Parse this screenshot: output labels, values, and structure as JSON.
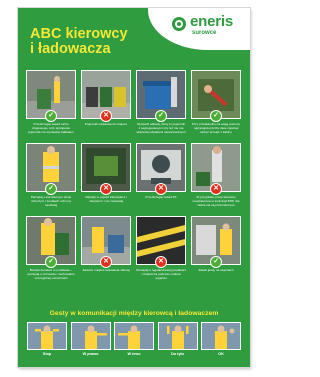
{
  "brand": {
    "name": "eneris",
    "sub": "surowce",
    "logo_icon": "eneris-logo-icon",
    "accent": "#2e9c3f",
    "highlight": "#f3e838"
  },
  "title": {
    "line1": "ABC kierowcy",
    "line2": "i ładowacza"
  },
  "rules": [
    {
      "status": "ok",
      "mark": "✓",
      "icon": "check-icon",
      "caption": "Przestrzegaj zasad ruchu drogowego, przy sprzątaniu pojemnik nie wystawiaj zakładem"
    },
    {
      "status": "bad",
      "mark": "✕",
      "icon": "cross-icon",
      "caption": "Pojemnik odstawiaj na miejsce"
    },
    {
      "status": "ok",
      "mark": "✓",
      "icon": "check-icon",
      "caption": "Sprawdź odpady, który to pojemnik z segregowanymi czy też nie ma skażenia odpadami niesortowanymi"
    },
    {
      "status": "ok",
      "mark": "✓",
      "icon": "check-icon",
      "caption": "Przy przeładunku na wagę pomocy najmniejszej liczby dwie zgodnej ułożyć przejść z kabiny"
    },
    {
      "status": "ok",
      "mark": "✓",
      "icon": "check-icon",
      "caption": "Pamiętaj o kompletnym stroju roboczym i środkach ochrony osobistej"
    },
    {
      "status": "bad",
      "mark": "✕",
      "icon": "cross-icon",
      "caption": "Odpady w pojazd zabezpiecz i ubezpiecz i nie zostawiaj"
    },
    {
      "status": "bad",
      "mark": "✕",
      "icon": "cross-icon",
      "caption": "Przestrzegaj zasad 3S"
    },
    {
      "status": "bad",
      "mark": "✕",
      "icon": "cross-icon",
      "caption": "W przypadku pracy kierowcy nieobsłużona w instrukcji BHP, dla ciebie nie są przeznaczone"
    },
    {
      "status": "ok",
      "mark": "✓",
      "icon": "check-icon",
      "caption": "Bezpieczeństwo to podstawa – pamiętaj o rozmowie i zachowaniu szczególnej ostrożności"
    },
    {
      "status": "bad",
      "mark": "✕",
      "icon": "cross-icon",
      "caption": "Zawsze miejsce ładowania zbieraj"
    },
    {
      "status": "bad",
      "mark": "✕",
      "icon": "cross-icon",
      "caption": "Pamiętaj o regulaminowej prędkości i zwłaszcza podczas cofania pojazdu"
    },
    {
      "status": "ok",
      "mark": "✓",
      "icon": "check-icon",
      "caption": "Zakaz jazdy na stopniach"
    }
  ],
  "gestures": {
    "title": "Gesty w komunikacji między kierowcą i ładowaczem",
    "items": [
      {
        "label": "Stop"
      },
      {
        "label": "W prawo"
      },
      {
        "label": "W lewo"
      },
      {
        "label": "Do tyłu"
      },
      {
        "label": "OK"
      }
    ]
  }
}
